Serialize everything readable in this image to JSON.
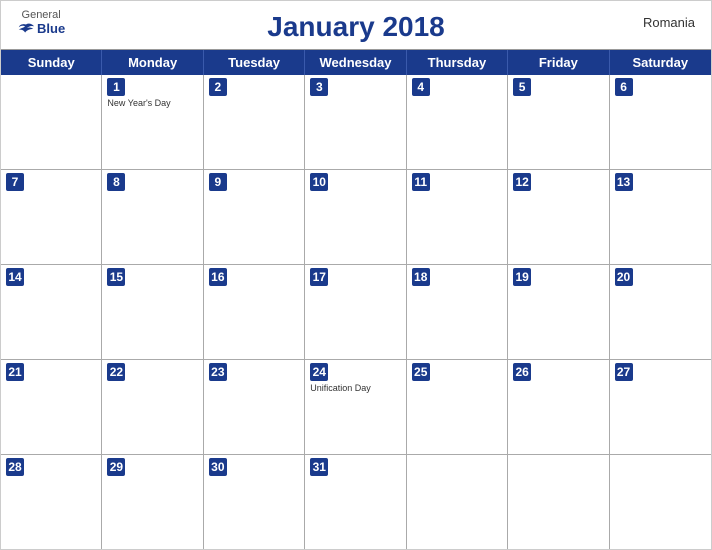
{
  "header": {
    "logo": {
      "general": "General",
      "blue": "Blue"
    },
    "title": "January 2018",
    "country": "Romania"
  },
  "dayHeaders": [
    "Sunday",
    "Monday",
    "Tuesday",
    "Wednesday",
    "Thursday",
    "Friday",
    "Saturday"
  ],
  "weeks": [
    [
      {
        "day": "",
        "holiday": ""
      },
      {
        "day": "1",
        "holiday": "New Year's Day"
      },
      {
        "day": "2",
        "holiday": ""
      },
      {
        "day": "3",
        "holiday": ""
      },
      {
        "day": "4",
        "holiday": ""
      },
      {
        "day": "5",
        "holiday": ""
      },
      {
        "day": "6",
        "holiday": ""
      }
    ],
    [
      {
        "day": "7",
        "holiday": ""
      },
      {
        "day": "8",
        "holiday": ""
      },
      {
        "day": "9",
        "holiday": ""
      },
      {
        "day": "10",
        "holiday": ""
      },
      {
        "day": "11",
        "holiday": ""
      },
      {
        "day": "12",
        "holiday": ""
      },
      {
        "day": "13",
        "holiday": ""
      }
    ],
    [
      {
        "day": "14",
        "holiday": ""
      },
      {
        "day": "15",
        "holiday": ""
      },
      {
        "day": "16",
        "holiday": ""
      },
      {
        "day": "17",
        "holiday": ""
      },
      {
        "day": "18",
        "holiday": ""
      },
      {
        "day": "19",
        "holiday": ""
      },
      {
        "day": "20",
        "holiday": ""
      }
    ],
    [
      {
        "day": "21",
        "holiday": ""
      },
      {
        "day": "22",
        "holiday": ""
      },
      {
        "day": "23",
        "holiday": ""
      },
      {
        "day": "24",
        "holiday": "Unification Day"
      },
      {
        "day": "25",
        "holiday": ""
      },
      {
        "day": "26",
        "holiday": ""
      },
      {
        "day": "27",
        "holiday": ""
      }
    ],
    [
      {
        "day": "28",
        "holiday": ""
      },
      {
        "day": "29",
        "holiday": ""
      },
      {
        "day": "30",
        "holiday": ""
      },
      {
        "day": "31",
        "holiday": ""
      },
      {
        "day": "",
        "holiday": ""
      },
      {
        "day": "",
        "holiday": ""
      },
      {
        "day": "",
        "holiday": ""
      }
    ]
  ]
}
